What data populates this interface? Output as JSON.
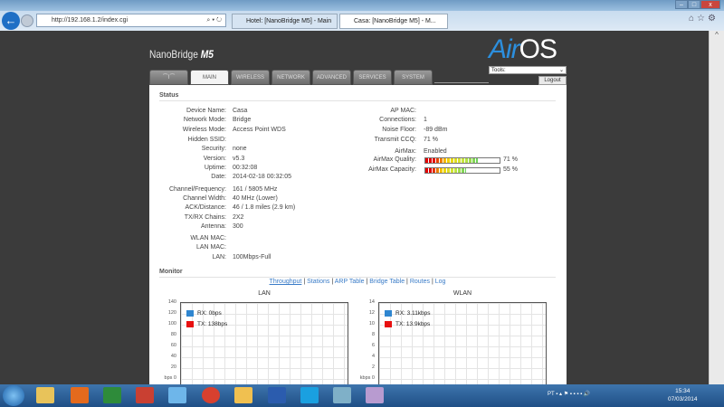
{
  "browser": {
    "url": "http://192.168.1.2/index.cgi",
    "tabs": [
      {
        "label": "Hotel: [NanoBridge M5] - Main"
      },
      {
        "label": "Casa: [NanoBridge M5] - M..."
      }
    ],
    "addr_tools": "⌕ ▾ ↻",
    "back": "←"
  },
  "header": {
    "product": "NanoBridge",
    "model": "M5",
    "brand_air": "Air",
    "brand_os": "OS",
    "tools_select": "Tools:",
    "logout": "Logout"
  },
  "nav": {
    "tabs": [
      "MAIN",
      "WIRELESS",
      "NETWORK",
      "ADVANCED",
      "SERVICES",
      "SYSTEM"
    ],
    "active": "MAIN"
  },
  "status": {
    "title": "Status",
    "left": [
      {
        "label": "Device Name:",
        "value": "Casa"
      },
      {
        "label": "Network Mode:",
        "value": "Bridge"
      },
      {
        "label": "Wireless Mode:",
        "value": "Access Point WDS"
      },
      {
        "label": "Hidden SSID:",
        "value": ""
      },
      {
        "label": "Security:",
        "value": "none"
      },
      {
        "label": "Version:",
        "value": "v5.3"
      },
      {
        "label": "Uptime:",
        "value": "00:32:08"
      },
      {
        "label": "Date:",
        "value": "2014-02-18 00:32:05"
      },
      {
        "label": "Channel/Frequency:",
        "value": "161 / 5805 MHz"
      },
      {
        "label": "Channel Width:",
        "value": "40 MHz (Lower)"
      },
      {
        "label": "ACK/Distance:",
        "value": "46 / 1.8 miles (2.9 km)"
      },
      {
        "label": "TX/RX Chains:",
        "value": "2X2"
      },
      {
        "label": "Antenna:",
        "value": "300"
      },
      {
        "label": "WLAN MAC:",
        "value": ""
      },
      {
        "label": "LAN MAC:",
        "value": ""
      },
      {
        "label": "LAN:",
        "value": "100Mbps-Full"
      }
    ],
    "right": [
      {
        "label": "AP MAC:",
        "value": ""
      },
      {
        "label": "Connections:",
        "value": "1"
      },
      {
        "label": "Noise Floor:",
        "value": "-89 dBm"
      },
      {
        "label": "Transmit CCQ:",
        "value": "71 %"
      },
      {
        "label": "AirMax:",
        "value": "Enabled"
      }
    ],
    "airmax_quality": {
      "label": "AirMax Quality:",
      "percent": 71,
      "text": "71 %"
    },
    "airmax_capacity": {
      "label": "AirMax Capacity:",
      "percent": 55,
      "text": "55 %"
    }
  },
  "monitor": {
    "title": "Monitor",
    "links": [
      "Throughput",
      "Stations",
      "ARP Table",
      "Bridge Table",
      "Routes",
      "Log"
    ],
    "sep": "|",
    "lan": {
      "title": "LAN",
      "unit": "bps 0",
      "ticks": [
        "140",
        "120",
        "100",
        "80",
        "60",
        "40",
        "20"
      ],
      "rx": "RX: 0bps",
      "tx": "TX: 138bps"
    },
    "wlan": {
      "title": "WLAN",
      "unit": "kbps 0",
      "ticks": [
        "14",
        "12",
        "10",
        "8",
        "6",
        "4",
        "2"
      ],
      "rx": "RX: 3.11kbps",
      "tx": "TX: 13.9kbps"
    },
    "colors": {
      "rx": "#2f86d0",
      "tx": "#e81010"
    }
  },
  "taskbar": {
    "lang": "PT",
    "time": "15:34",
    "date": "07/03/2014"
  }
}
